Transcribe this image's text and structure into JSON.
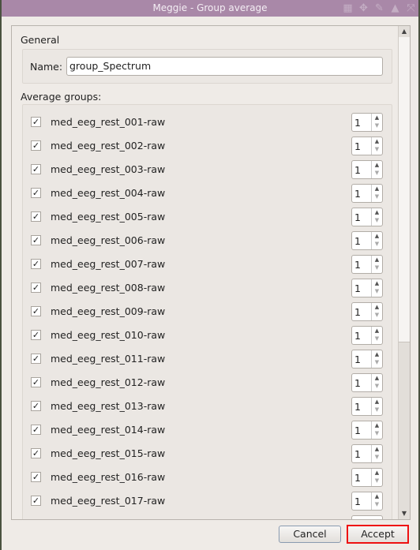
{
  "window": {
    "title": "Meggie - Group average",
    "title_icons": [
      "tile-icon",
      "move-icon",
      "pin-icon",
      "shade-icon",
      "maximize-icon"
    ]
  },
  "general": {
    "label": "General",
    "name_label": "Name:",
    "name_value": "group_Spectrum"
  },
  "groups": {
    "label": "Average groups:",
    "items": [
      {
        "label": "med_eeg_rest_001-raw",
        "checked": true,
        "value": "1"
      },
      {
        "label": "med_eeg_rest_002-raw",
        "checked": true,
        "value": "1"
      },
      {
        "label": "med_eeg_rest_003-raw",
        "checked": true,
        "value": "1"
      },
      {
        "label": "med_eeg_rest_004-raw",
        "checked": true,
        "value": "1"
      },
      {
        "label": "med_eeg_rest_005-raw",
        "checked": true,
        "value": "1"
      },
      {
        "label": "med_eeg_rest_006-raw",
        "checked": true,
        "value": "1"
      },
      {
        "label": "med_eeg_rest_007-raw",
        "checked": true,
        "value": "1"
      },
      {
        "label": "med_eeg_rest_008-raw",
        "checked": true,
        "value": "1"
      },
      {
        "label": "med_eeg_rest_009-raw",
        "checked": true,
        "value": "1"
      },
      {
        "label": "med_eeg_rest_010-raw",
        "checked": true,
        "value": "1"
      },
      {
        "label": "med_eeg_rest_011-raw",
        "checked": true,
        "value": "1"
      },
      {
        "label": "med_eeg_rest_012-raw",
        "checked": true,
        "value": "1"
      },
      {
        "label": "med_eeg_rest_013-raw",
        "checked": true,
        "value": "1"
      },
      {
        "label": "med_eeg_rest_014-raw",
        "checked": true,
        "value": "1"
      },
      {
        "label": "med_eeg_rest_015-raw",
        "checked": true,
        "value": "1"
      },
      {
        "label": "med_eeg_rest_016-raw",
        "checked": true,
        "value": "1"
      },
      {
        "label": "med_eeg_rest_017-raw",
        "checked": true,
        "value": "1"
      }
    ]
  },
  "buttons": {
    "cancel": "Cancel",
    "accept": "Accept"
  },
  "colors": {
    "titlebar": "#a988a8",
    "focus_border": "#ee1111"
  }
}
